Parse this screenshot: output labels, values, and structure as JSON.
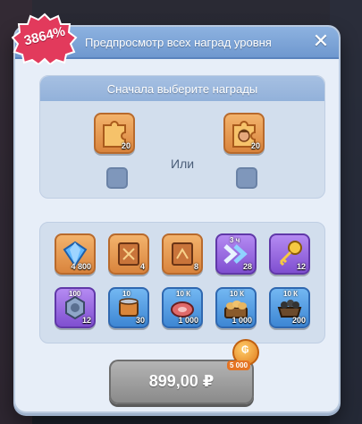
{
  "badge": {
    "text": "3864%"
  },
  "dialog": {
    "title": "Предпросмотр всех наград уровня",
    "close_icon": "close-icon",
    "choice": {
      "subtitle": "Сначала выберите награды",
      "or_label": "Или",
      "options": [
        {
          "icon": "puzzle-piece-icon",
          "qty": "20",
          "color": "orange",
          "checked": false
        },
        {
          "icon": "hero-puzzle-piece-icon",
          "qty": "20",
          "color": "orange",
          "checked": false
        }
      ]
    },
    "rewards": {
      "rows": [
        [
          {
            "icon": "diamond-icon",
            "qty": "4 800",
            "top": "",
            "color": "orange"
          },
          {
            "icon": "book-icon",
            "qty": "4",
            "top": "",
            "color": "orange"
          },
          {
            "icon": "book-icon",
            "qty": "8",
            "top": "",
            "color": "orange"
          },
          {
            "icon": "double-chevron-icon",
            "qty": "28",
            "top": "3 ч",
            "color": "purple"
          },
          {
            "icon": "key-icon",
            "qty": "12",
            "top": "",
            "color": "purple"
          }
        ],
        [
          {
            "icon": "gear-nut-icon",
            "qty": "12",
            "top": "100",
            "color": "purple"
          },
          {
            "icon": "canned-food-icon",
            "qty": "30",
            "top": "10",
            "color": "blue"
          },
          {
            "icon": "meat-icon",
            "qty": "1 000",
            "top": "10 К",
            "color": "blue"
          },
          {
            "icon": "bread-basket-icon",
            "qty": "1 000",
            "top": "10 К",
            "color": "blue"
          },
          {
            "icon": "coal-cart-icon",
            "qty": "200",
            "top": "10 К",
            "color": "blue"
          }
        ]
      ]
    },
    "purchase": {
      "price": "899,00 ₽",
      "coin_amount": "5 000",
      "coin_symbol": "₲"
    }
  },
  "colors": {
    "header": "#7ea6d8",
    "panel": "#e7eef8",
    "badge": "#e23a5c",
    "price_button": "#9e9e9e",
    "coin": "#e47424"
  }
}
